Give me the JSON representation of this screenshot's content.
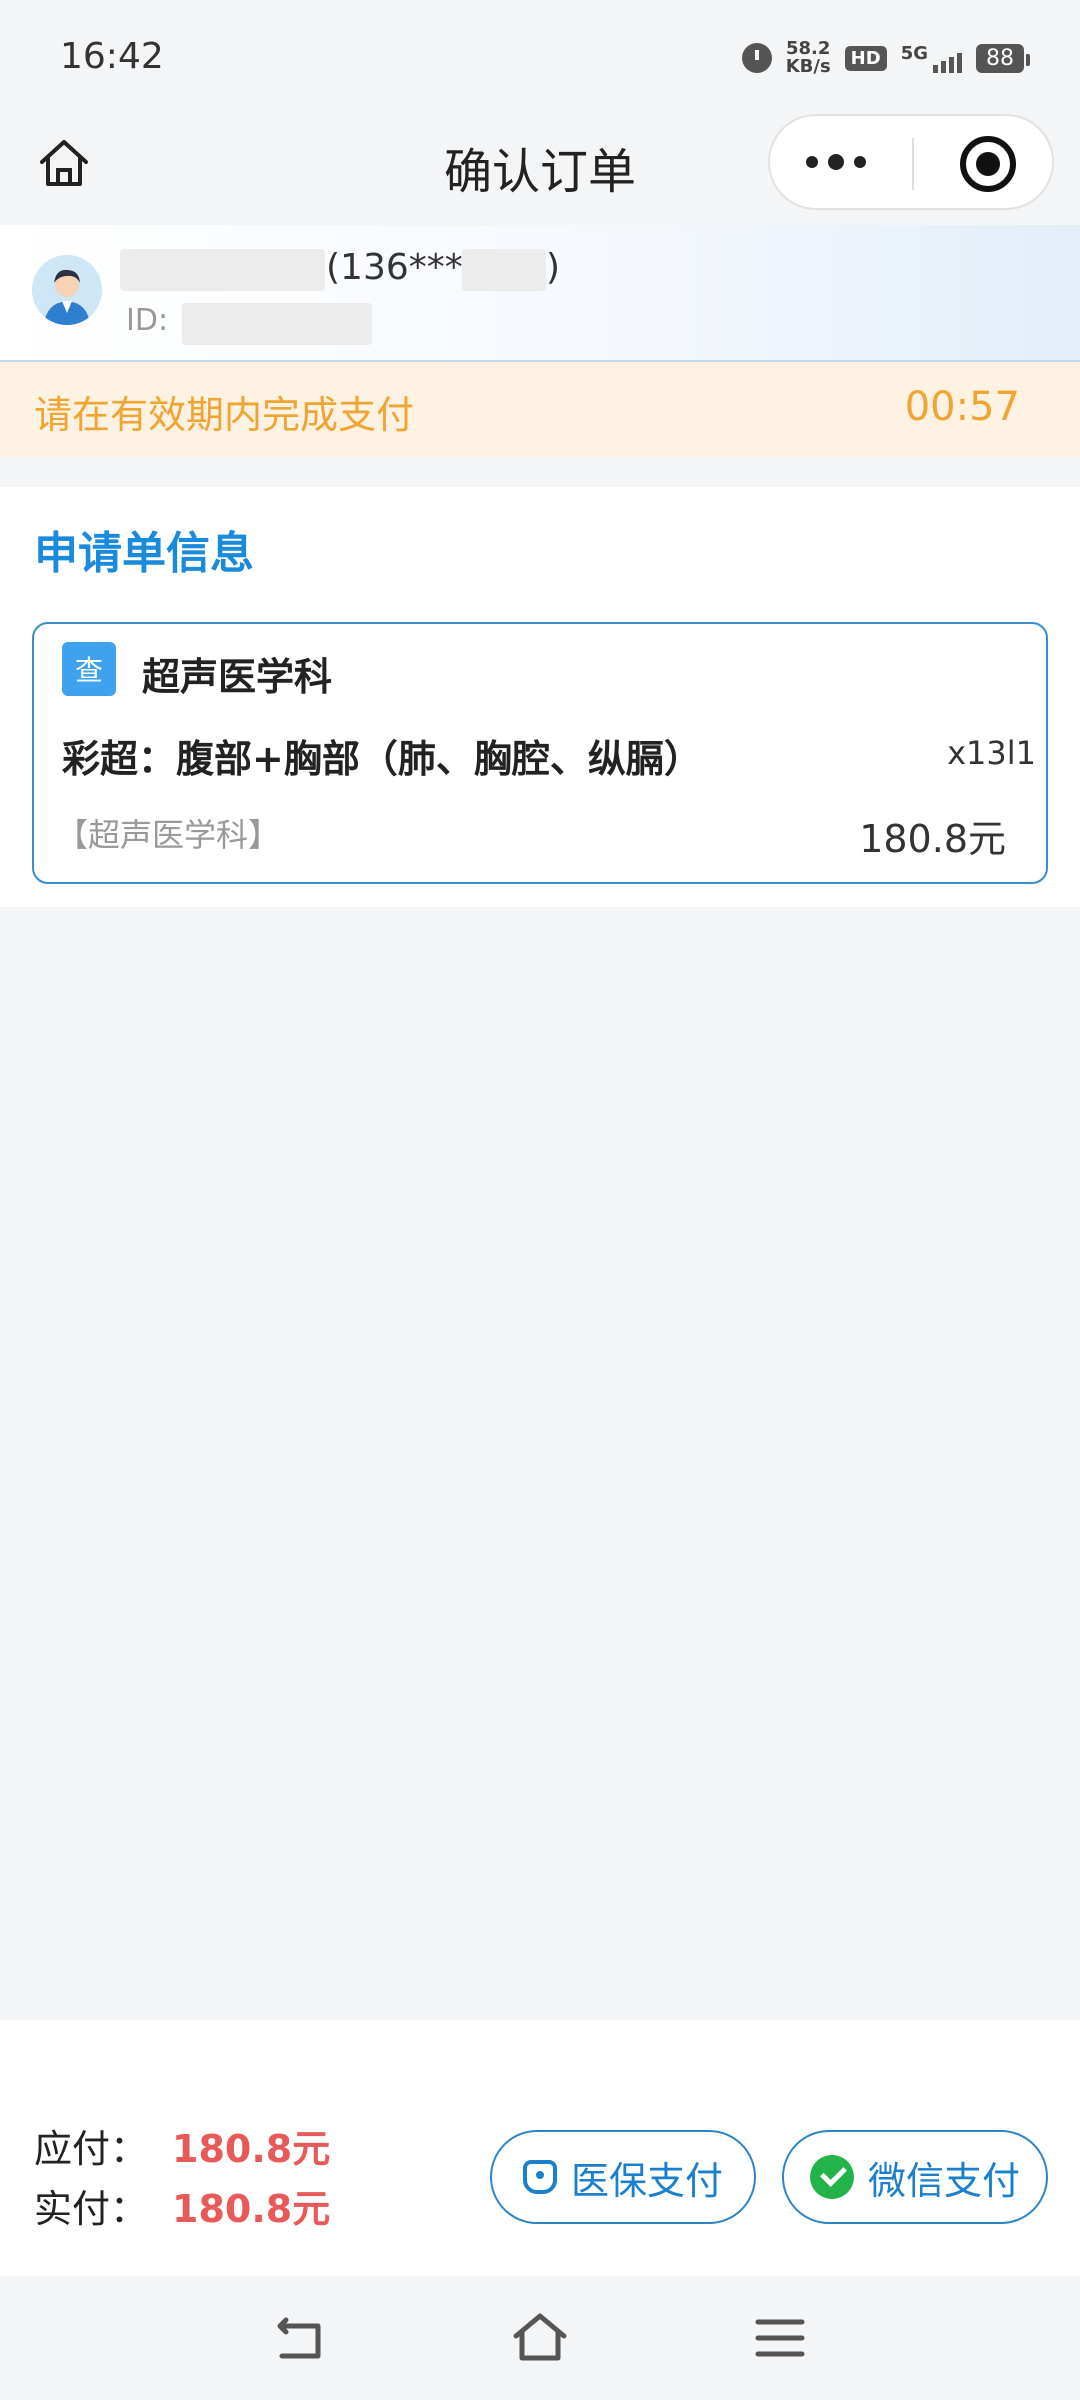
{
  "status_bar": {
    "time": "16:42",
    "net_speed_value": "58.2",
    "net_speed_unit": "KB/s",
    "hd_label": "HD",
    "signal_label": "5G",
    "battery": "88"
  },
  "nav": {
    "title": "确认订单"
  },
  "user": {
    "phone_prefix": "(136***",
    "phone_suffix": ")",
    "id_label": "ID:"
  },
  "notice": {
    "message": "请在有效期内完成支付",
    "countdown": "00:57"
  },
  "application": {
    "section_title": "申请单信息",
    "badge": "查",
    "department": "超声医学科",
    "item_name": "彩超：腹部+胸部（肺、胸腔、纵膈）",
    "quantity": "x13l1",
    "item_department": "【超声医学科】",
    "price": "180.8元"
  },
  "payment": {
    "due_label": "应付：",
    "due_amount": "180.8元",
    "actual_label": "实付：",
    "actual_amount": "180.8元",
    "insurance_button": "医保支付",
    "wechat_button": "微信支付"
  },
  "colors": {
    "accent_blue": "#1a8bdc",
    "notice_orange": "#f0a533",
    "amount_red": "#e85a5a",
    "wechat_green": "#23b34a"
  }
}
